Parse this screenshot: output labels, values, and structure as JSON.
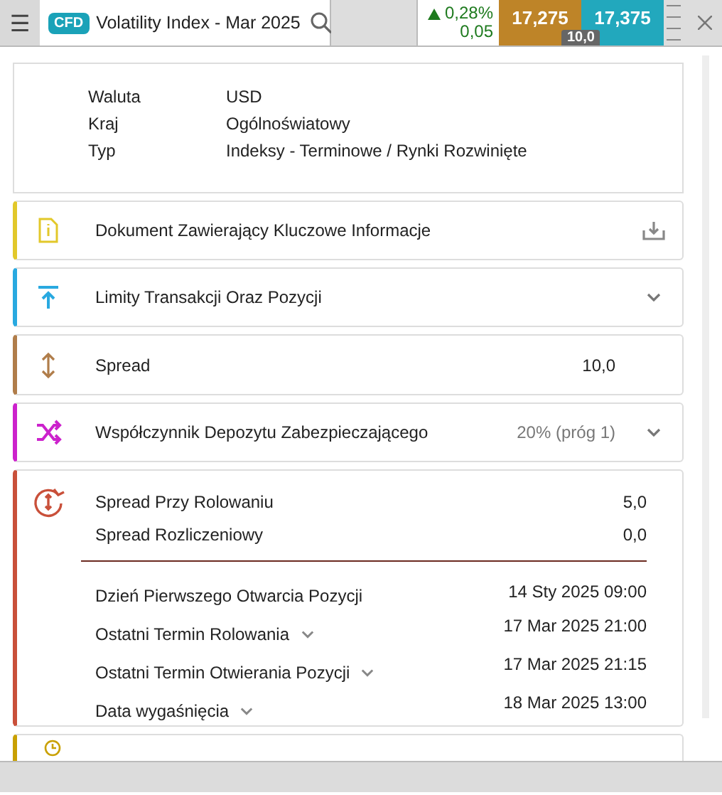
{
  "header": {
    "menu_icon": "☰",
    "badge": "CFD",
    "title": "Volatility Index - Mar 2025",
    "change_pct": "0,28%",
    "change_abs": "0,05",
    "trend_up": true,
    "sell": "17,275",
    "buy": "17,375",
    "spread": "10,0"
  },
  "info": [
    {
      "label": "Waluta",
      "value": "USD"
    },
    {
      "label": "Kraj",
      "value": "Ogólnoświatowy"
    },
    {
      "label": "Typ",
      "value": "Indeksy - Terminowe / Rynki Rozwinięte"
    }
  ],
  "sections": [
    {
      "kind": "download",
      "color": "#e2c82a",
      "label": "Dokument Zawierający Kluczowe Informacje"
    },
    {
      "kind": "expand",
      "color": "#29a9e0",
      "label": "Limity Transakcji Oraz Pozycji"
    },
    {
      "kind": "value",
      "color": "#b07d4a",
      "label": "Spread",
      "value": "10,0"
    },
    {
      "kind": "expand",
      "color": "#cc22cc",
      "label": "Współczynnik Depozytu Zabezpieczającego",
      "value": "20% (próg 1)"
    }
  ],
  "rollover": {
    "color": "#c9503a",
    "top_rows": [
      {
        "label": "Spread Przy Rolowaniu",
        "value": "5,0"
      },
      {
        "label": "Spread Rozliczeniowy",
        "value": "0,0"
      }
    ],
    "date_rows": [
      {
        "label": "Dzień Pierwszego Otwarcia Pozycji",
        "value": "14 Sty 2025 09:00",
        "expandable": false
      },
      {
        "label": "Ostatni Termin Rolowania",
        "value": "17 Mar 2025 21:00",
        "expandable": true
      },
      {
        "label": "Ostatni Termin Otwierania Pozycji",
        "value": "17 Mar 2025 21:15",
        "expandable": true
      },
      {
        "label": "Data wygaśnięcia",
        "value": "18 Mar 2025 13:00",
        "expandable": true
      }
    ]
  },
  "hours": {
    "color": "#c9a000"
  }
}
